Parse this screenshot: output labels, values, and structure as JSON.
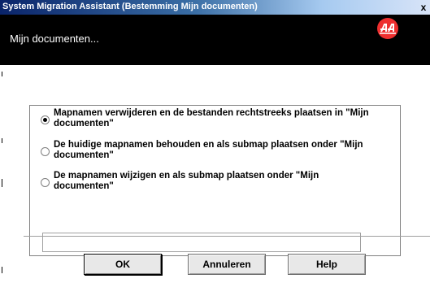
{
  "window": {
    "title": "System Migration Assistant (Bestemming Mijn documenten)",
    "close_label": "x"
  },
  "header": {
    "title": "Mijn documenten..."
  },
  "options": [
    {
      "label": "Mapnamen verwijderen en de bestanden rechtstreeks plaatsen in \"Mijn documenten\"",
      "selected": true
    },
    {
      "label": "De huidige mapnamen behouden en als submap plaatsen onder \"Mijn documenten\"",
      "selected": false
    },
    {
      "label": "De mapnamen wijzigen en als submap plaatsen onder \"Mijn documenten\"",
      "selected": false
    }
  ],
  "folder_name_input": {
    "value": ""
  },
  "buttons": {
    "ok": "OK",
    "cancel": "Annuleren",
    "help": "Help"
  },
  "colors": {
    "header_bg": "#000000",
    "logo": "#ee2f2f",
    "title_gradient_start": "#0a246a"
  }
}
